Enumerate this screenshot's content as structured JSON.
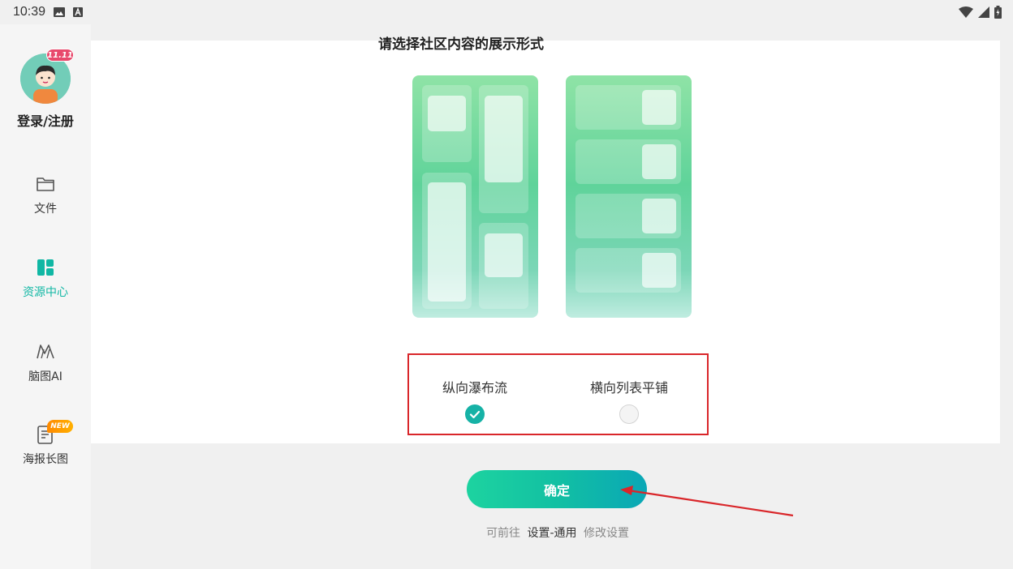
{
  "status_bar": {
    "time": "10:39",
    "left_icons": [
      "image-icon",
      "a-badge-icon"
    ],
    "right_icons": [
      "wifi-icon",
      "signal-icon",
      "battery-icon"
    ]
  },
  "sidebar": {
    "badge": "11.11",
    "login_label": "登录/注册",
    "items": [
      {
        "label": "文件",
        "icon": "folder-icon",
        "active": false
      },
      {
        "label": "资源中心",
        "icon": "grid-icon",
        "active": true
      },
      {
        "label": "脑图AI",
        "icon": "mindmap-ai-icon",
        "active": false
      },
      {
        "label": "海报长图",
        "icon": "poster-icon",
        "active": false,
        "badge": "NEW"
      }
    ]
  },
  "main": {
    "title": "请选择社区内容的展示形式",
    "options": [
      {
        "label": "纵向瀑布流",
        "selected": true
      },
      {
        "label": "横向列表平铺",
        "selected": false
      }
    ],
    "confirm_label": "确定",
    "hint_prefix": "可前往",
    "hint_link": "设置-通用",
    "hint_suffix": "修改设置"
  },
  "colors": {
    "accent": "#10b7a4",
    "highlight": "#d9262a"
  }
}
